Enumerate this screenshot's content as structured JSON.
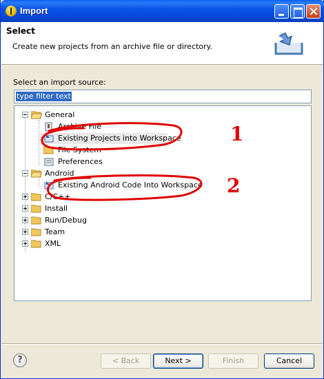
{
  "window": {
    "title": "Import"
  },
  "banner": {
    "title": "Select",
    "description": "Create new projects from an archive file or directory."
  },
  "source": {
    "label": "Select an import source:",
    "filter_value": "type filter text"
  },
  "tree": {
    "general": {
      "label": "General",
      "items": [
        "Archive File",
        "Existing Projects into Workspace",
        "File System",
        "Preferences"
      ]
    },
    "android": {
      "label": "Android",
      "items": [
        "Existing Android Code Into Workspace"
      ]
    },
    "collapsed": [
      "C/C++",
      "Install",
      "Run/Debug",
      "Team",
      "XML"
    ]
  },
  "annotations": [
    "1",
    "2"
  ],
  "buttons": {
    "back": "< Back",
    "next": "Next >",
    "finish": "Finish",
    "cancel": "Cancel"
  },
  "colors": {
    "annotation": "#e00000",
    "title_bar": "#0a52e8",
    "selection": "#316ac5"
  }
}
